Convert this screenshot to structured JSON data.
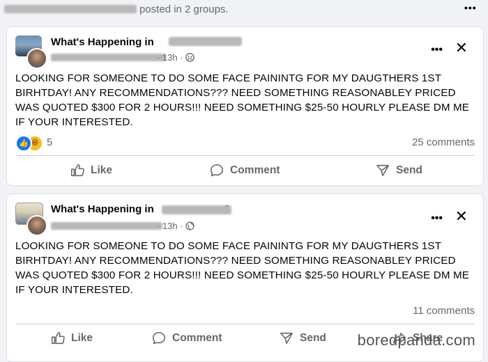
{
  "header": {
    "suffix_text": "posted in 2 groups."
  },
  "posts": [
    {
      "group_name": "What's Happening in",
      "time": "13h",
      "privacy_icon": "group-icon",
      "text": "LOOKING FOR SOMEONE TO DO SOME FACE PAININTG FOR MY DAUGTHERS 1ST BIRHTDAY! ANY RECOMMENDATIONS??? NEED SOMETHING REASONABLEY PRICED WAS QUOTED $300 FOR 2 HOURS!!! NEED SOMETHING $25-50 HOURLY PLEASE DM ME IF YOUR INTERESTED.",
      "reaction_count": "5",
      "comments": "25 comments",
      "actions": {
        "like": "Like",
        "comment": "Comment",
        "send": "Send"
      }
    },
    {
      "group_name": "What's Happening in",
      "group_name_suffix": "?",
      "time": "13h",
      "privacy_icon": "globe-icon",
      "text": "LOOKING FOR SOMEONE TO DO SOME FACE PAININTG FOR MY DAUGTHERS 1ST BIRHTDAY! ANY RECOMMENDATIONS??? NEED SOMETHING REASONABLEY PRICED WAS QUOTED $300 FOR 2 HOURS!!! NEED SOMETHING $25-50 HOURLY PLEASE DM ME IF YOUR INTERESTED.",
      "comments": "11 comments",
      "actions": {
        "like": "Like",
        "comment": "Comment",
        "send": "Send",
        "share": "Share"
      }
    }
  ],
  "watermark": "boredpanda.com",
  "colors": {
    "secondary_text": "#65676b",
    "like_blue": "#1877f2",
    "haha_yellow": "#f7b928"
  }
}
